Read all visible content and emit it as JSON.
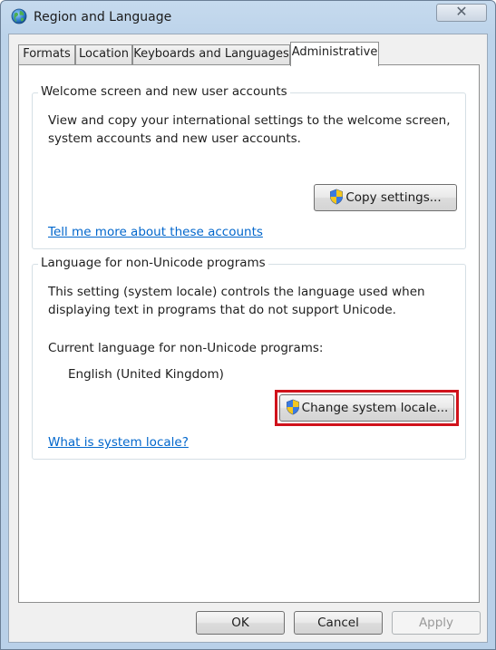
{
  "window": {
    "title": "Region and Language",
    "close_label": "✕"
  },
  "tabs": [
    {
      "label": "Formats"
    },
    {
      "label": "Location"
    },
    {
      "label": "Keyboards and Languages"
    },
    {
      "label": "Administrative",
      "active": true
    }
  ],
  "welcome_group": {
    "title": "Welcome screen and new user accounts",
    "description_line1": "View and copy your international settings to the welcome screen,",
    "description_line2": "system accounts and new user accounts.",
    "copy_button": "Copy settings...",
    "link": "Tell me more about these accounts"
  },
  "nonunicode_group": {
    "title": "Language for non-Unicode programs",
    "description_line1": "This setting (system locale) controls the language used when",
    "description_line2": "displaying text in programs that do not support Unicode.",
    "current_label": "Current language for non-Unicode programs:",
    "current_value": "English (United Kingdom)",
    "change_button": "Change system locale...",
    "link": "What is system locale?"
  },
  "footer": {
    "ok": "OK",
    "cancel": "Cancel",
    "apply": "Apply"
  },
  "colors": {
    "link": "#0066cc",
    "highlight": "#d0121b"
  }
}
